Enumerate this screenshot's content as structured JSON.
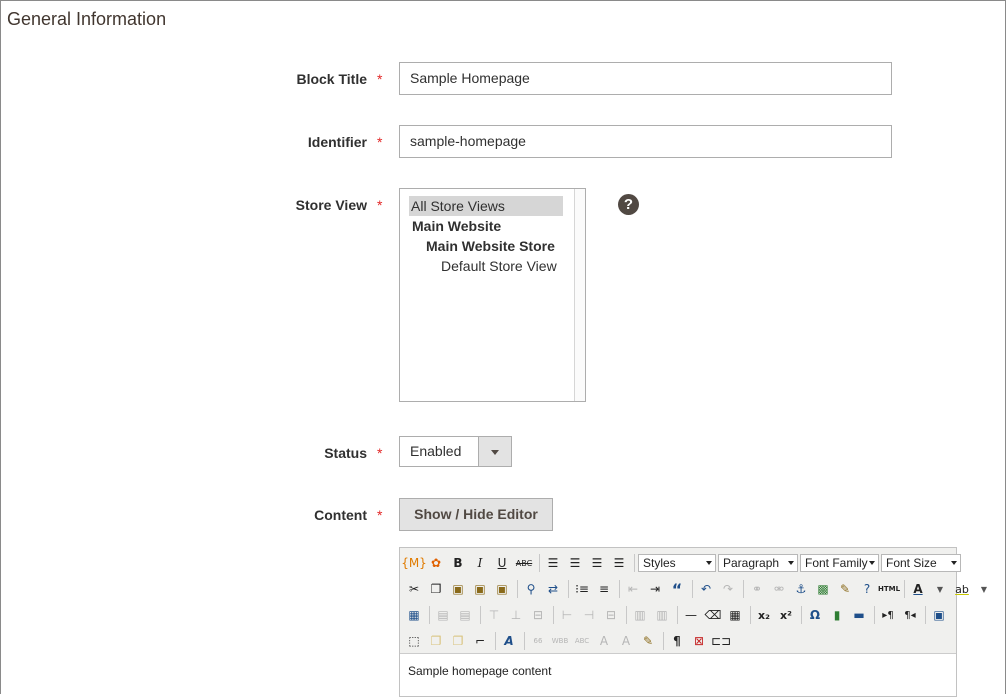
{
  "section": {
    "title": "General Information"
  },
  "required_mark": "*",
  "fields": {
    "block_title": {
      "label": "Block Title",
      "value": "Sample Homepage"
    },
    "identifier": {
      "label": "Identifier",
      "value": "sample-homepage"
    },
    "store_view": {
      "label": "Store View",
      "options": [
        "All Store Views",
        "Main Website",
        "Main Website Store",
        "Default Store View"
      ],
      "selected": "All Store Views",
      "help_glyph": "?"
    },
    "status": {
      "label": "Status",
      "value": "Enabled"
    },
    "content": {
      "label": "Content",
      "toggle_button": "Show / Hide Editor"
    }
  },
  "editor": {
    "selects": {
      "styles": "Styles",
      "paragraph": "Paragraph",
      "font_family": "Font Family",
      "font_size": "Font Size"
    },
    "body_text": "Sample homepage content",
    "glyphs": {
      "bold": "B",
      "italic": "I",
      "underline": "U",
      "strike": "ABC",
      "blockquote": "“",
      "html": "HTML",
      "subscript": "x₂",
      "superscript": "x²",
      "omega": "Ω",
      "pilcrow": "¶",
      "font_color": "A",
      "highlight": "ab"
    }
  },
  "colors": {
    "required": "#e22626",
    "button_bg": "#e3e3e3",
    "help_icon": "#514943"
  }
}
